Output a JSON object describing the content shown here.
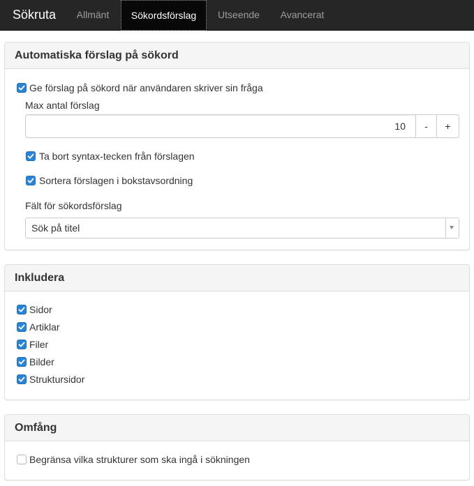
{
  "navbar": {
    "brand": "Sökruta",
    "tabs": [
      {
        "label": "Allmänt",
        "active": false
      },
      {
        "label": "Sökordsförslag",
        "active": true
      },
      {
        "label": "Utseende",
        "active": false
      },
      {
        "label": "Avancerat",
        "active": false
      }
    ]
  },
  "suggestions_panel": {
    "title": "Automatiska förslag på sökord",
    "enable": {
      "label": "Ge förslag på sökord när användaren skriver sin fråga",
      "checked": true
    },
    "max_label": "Max antal förslag",
    "max_value": "10",
    "decrement_label": "-",
    "increment_label": "+",
    "strip_syntax": {
      "label": "Ta bort syntax-tecken från förslagen",
      "checked": true
    },
    "sort_alpha": {
      "label": "Sortera förslagen i bokstavsordning",
      "checked": true
    },
    "field_label": "Fält för sökordsförslag",
    "field_selected": "Sök på titel"
  },
  "include_panel": {
    "title": "Inkludera",
    "items": [
      {
        "label": "Sidor",
        "checked": true
      },
      {
        "label": "Artiklar",
        "checked": true
      },
      {
        "label": "Filer",
        "checked": true
      },
      {
        "label": "Bilder",
        "checked": true
      },
      {
        "label": "Struktursidor",
        "checked": true
      }
    ]
  },
  "scope_panel": {
    "title": "Omfång",
    "limit": {
      "label": "Begränsa vilka strukturer som ska ingå i sökningen",
      "checked": false
    }
  },
  "colors": {
    "navbar_bg": "#262626",
    "checkbox_accent": "#2a84d6",
    "panel_heading_bg": "#f5f5f5"
  }
}
